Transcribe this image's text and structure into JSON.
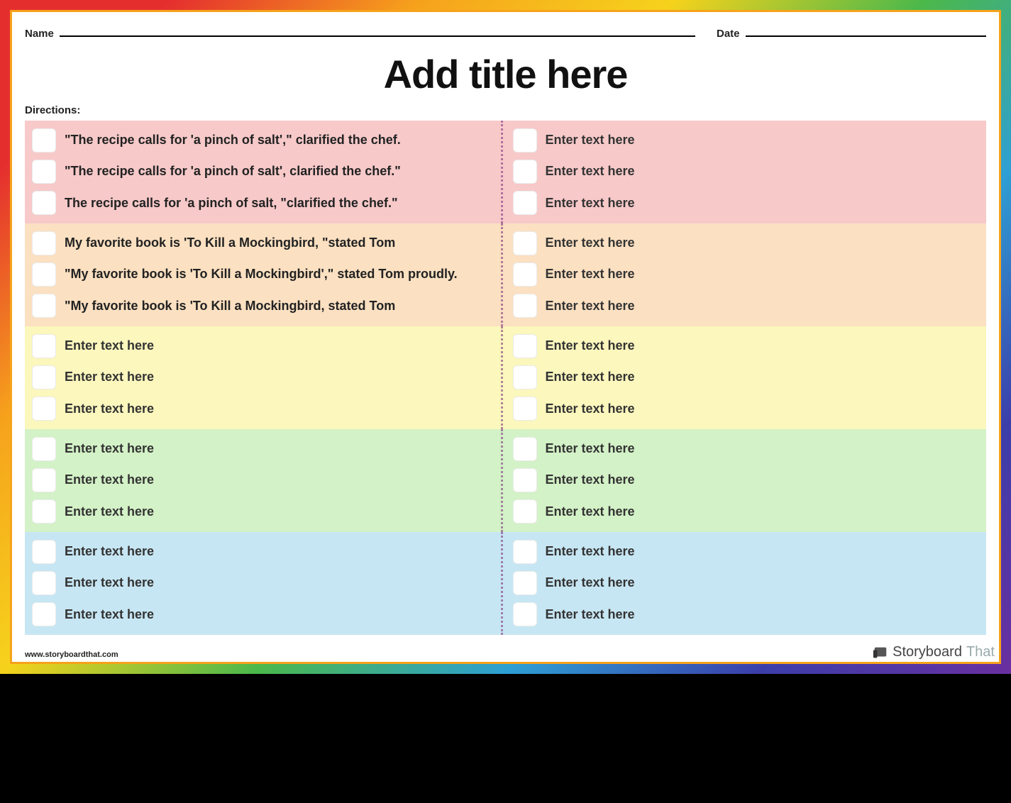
{
  "header": {
    "name_label": "Name",
    "date_label": "Date"
  },
  "title": "Add title here",
  "directions_label": "Directions:",
  "placeholder": "Enter text here",
  "bands": [
    {
      "color": "pink",
      "left": [
        "\"The recipe calls for 'a pinch of salt',\" clarified the chef.",
        "\"The recipe calls for 'a pinch of salt', clarified the chef.\"",
        "The recipe calls for 'a pinch of salt, \"clarified the chef.\""
      ],
      "right": [
        "Enter text here",
        "Enter text here",
        "Enter text here"
      ]
    },
    {
      "color": "orange",
      "left": [
        "My favorite book is 'To Kill a Mockingbird, \"stated Tom",
        "\"My favorite book is 'To Kill a Mockingbird',\" stated Tom proudly.",
        "\"My favorite book is 'To Kill a Mockingbird, stated Tom"
      ],
      "right": [
        "Enter text here",
        "Enter text here",
        "Enter text here"
      ]
    },
    {
      "color": "yellow",
      "left": [
        "Enter text here",
        "Enter text here",
        "Enter text here"
      ],
      "right": [
        "Enter text here",
        "Enter text here",
        "Enter text here"
      ]
    },
    {
      "color": "green",
      "left": [
        "Enter text here",
        "Enter text here",
        "Enter text here"
      ],
      "right": [
        "Enter text here",
        "Enter text here",
        "Enter text here"
      ]
    },
    {
      "color": "blue",
      "left": [
        "Enter text here",
        "Enter text here",
        "Enter text here"
      ],
      "right": [
        "Enter text here",
        "Enter text here",
        "Enter text here"
      ]
    }
  ],
  "footer_url": "www.storyboardthat.com",
  "brand": {
    "word1": "Storyboard",
    "word2": "That"
  }
}
